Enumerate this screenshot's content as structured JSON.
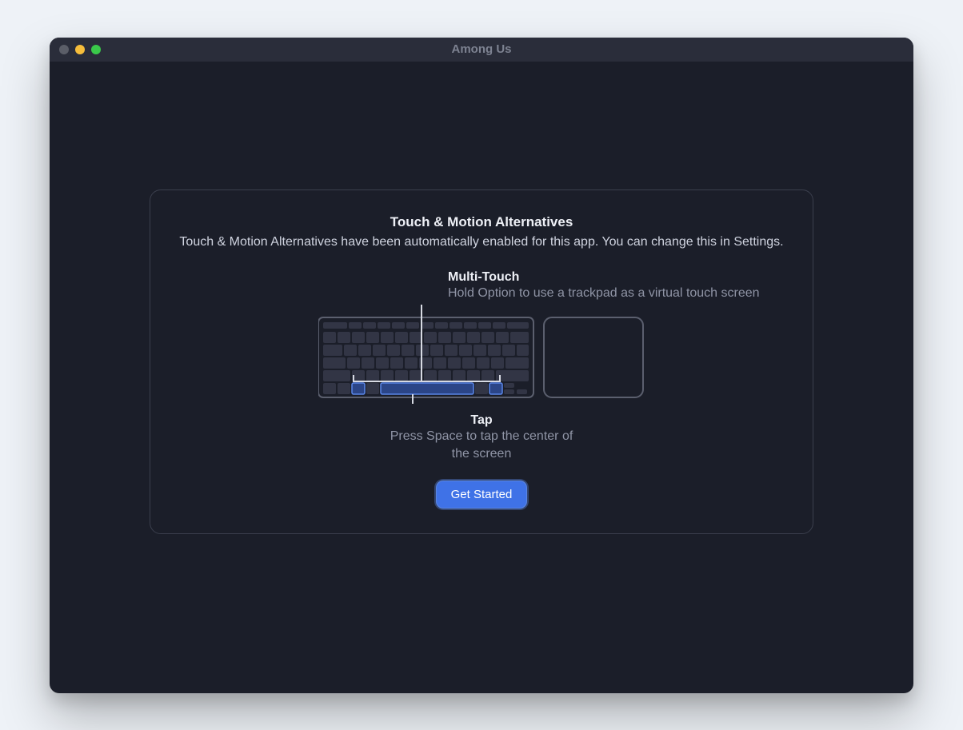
{
  "window": {
    "title": "Among Us"
  },
  "panel": {
    "heading": "Touch & Motion Alternatives",
    "description": "Touch & Motion Alternatives have been automatically enabled for this app. You can change this in Settings.",
    "multitouch": {
      "title": "Multi-Touch",
      "text": "Hold Option to use a trackpad as a virtual touch screen"
    },
    "tap": {
      "title": "Tap",
      "text": "Press Space to tap the center of the screen"
    },
    "cta": "Get Started"
  }
}
